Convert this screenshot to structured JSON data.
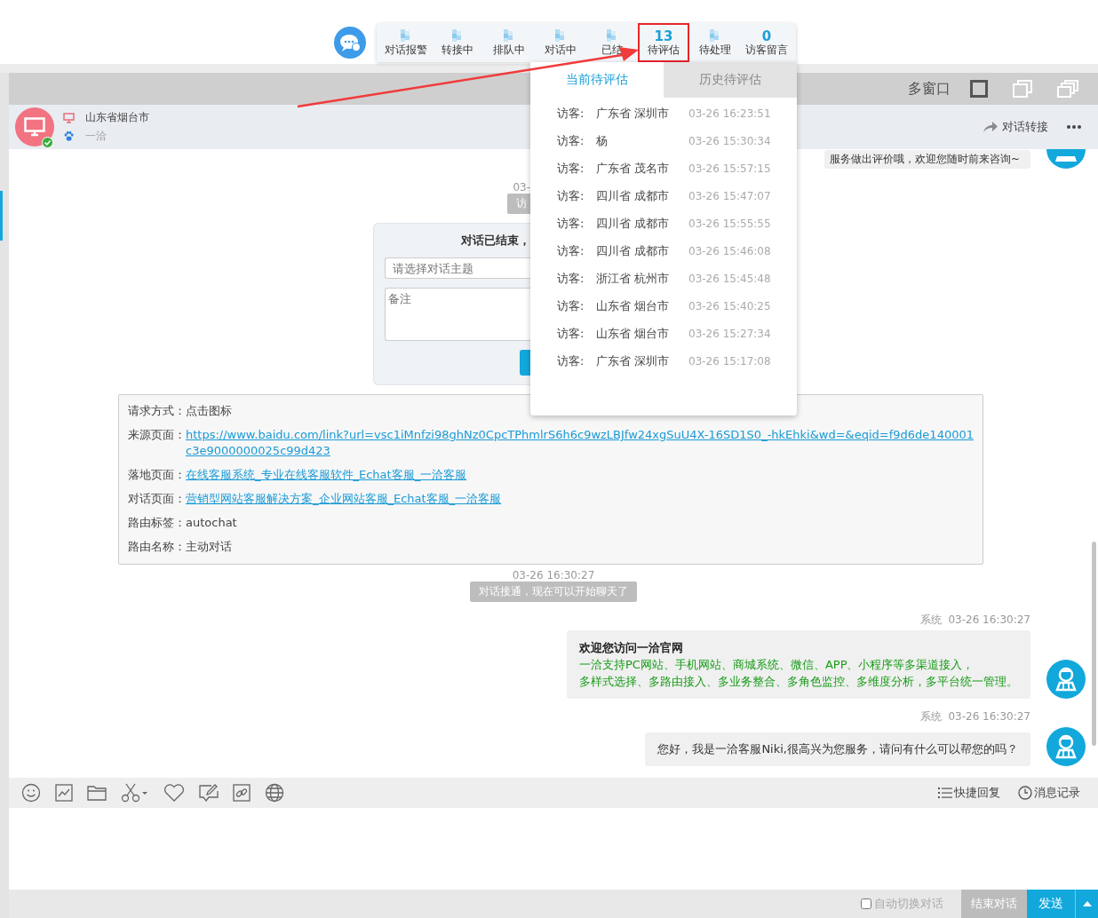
{
  "top_bar": {
    "tabs": [
      {
        "label": "对话报警",
        "highlighted": false
      },
      {
        "label": "转接中",
        "highlighted": false
      },
      {
        "label": "排队中",
        "highlighted": false
      },
      {
        "label": "对话中",
        "highlighted": false
      },
      {
        "label": "已结",
        "highlighted": false
      },
      {
        "label": "待评估",
        "count": "13",
        "highlighted": true
      },
      {
        "label": "待处理",
        "highlighted": false
      },
      {
        "label": "访客留言",
        "count": "0",
        "highlighted": false
      }
    ]
  },
  "popup": {
    "tabs": [
      {
        "label": "当前待评估",
        "selected": true
      },
      {
        "label": "历史待评估",
        "selected": false
      }
    ],
    "rows": [
      {
        "label": "访客:",
        "visitor": "广东省 深圳市",
        "time": "03-26 16:23:51"
      },
      {
        "label": "访客:",
        "visitor": "杨",
        "time": "03-26 15:30:34"
      },
      {
        "label": "访客:",
        "visitor": "广东省 茂名市",
        "time": "03-26 15:57:15"
      },
      {
        "label": "访客:",
        "visitor": "四川省 成都市",
        "time": "03-26 15:47:07"
      },
      {
        "label": "访客:",
        "visitor": "四川省 成都市",
        "time": "03-26 15:55:55"
      },
      {
        "label": "访客:",
        "visitor": "四川省 成都市",
        "time": "03-26 15:46:08"
      },
      {
        "label": "访客:",
        "visitor": "浙江省 杭州市",
        "time": "03-26 15:45:48"
      },
      {
        "label": "访客:",
        "visitor": "山东省 烟台市",
        "time": "03-26 15:40:25"
      },
      {
        "label": "访客:",
        "visitor": "山东省 烟台市",
        "time": "03-26 15:27:34"
      },
      {
        "label": "访客:",
        "visitor": "广东省 深圳市",
        "time": "03-26 15:17:08"
      }
    ]
  },
  "header": {
    "title": "多窗口"
  },
  "visitor": {
    "location": "山东省烟台市",
    "source": "一洽",
    "online": true,
    "transfer": "对话转接"
  },
  "chat": {
    "cut_message": "服务做出评价哦，欢迎您随时前来咨询~",
    "items": [
      {
        "kind": "time",
        "text": "03-",
        "cut": true
      },
      {
        "kind": "notice",
        "text": "访",
        "cut": true
      },
      {
        "kind": "end_form",
        "cut": true,
        "title": "对话已结束，",
        "topic_placeholder": "请选择对话主题",
        "note_placeholder": "备注"
      },
      {
        "kind": "info",
        "fields": [
          {
            "label": "请求方式：",
            "value": "点击图标",
            "link": false
          },
          {
            "label": "来源页面：",
            "value": "https://www.baidu.com/link?url=vsc1iMnfzi98ghNz0CpcTPhmlrS6h6c9wzLBJfw24xgSuU4X-16SD1S0_-hkEhki&wd=&eqid=f9d6de140001c3e9000000025c99d423",
            "link": true
          },
          {
            "label": "落地页面：",
            "value": "在线客服系统_专业在线客服软件_Echat客服_一洽客服",
            "link": true
          },
          {
            "label": "对话页面：",
            "value": "营销型网站客服解决方案_企业网站客服_Echat客服_一洽客服",
            "link": true
          },
          {
            "label": "路由标签：",
            "value": "autochat",
            "link": false
          },
          {
            "label": "路由名称：",
            "value": "主动对话",
            "link": false
          }
        ]
      },
      {
        "kind": "time",
        "text": "03-26 16:30:27",
        "cut": false
      },
      {
        "kind": "notice",
        "text": "对话接通，现在可以开始聊天了",
        "cut": false
      },
      {
        "kind": "message",
        "sender": "系统",
        "time": "03-26 16:30:27",
        "title": "欢迎您访问一洽官网",
        "lines": [
          "一洽支持PC网站、手机网站、商城系统、微信、APP、小程序等多渠道接入，",
          "多样式选择、多路由接入、多业务整合、多角色监控、多维度分析，多平台统一管理。"
        ]
      },
      {
        "kind": "message",
        "sender": "系统",
        "time": "03-26 16:30:27",
        "text": "您好，我是一洽客服Niki,很高兴为您服务，请问有什么可以帮您的吗？"
      }
    ]
  },
  "toolbar": {
    "actions": [
      {
        "label": "快捷回复",
        "kind": "list"
      },
      {
        "label": "消息记录",
        "kind": "clock"
      }
    ]
  },
  "footer": {
    "auto_switch": {
      "label": "自动切换对话",
      "checked": false
    },
    "end_button": "结束对话",
    "send_button": "发送"
  }
}
